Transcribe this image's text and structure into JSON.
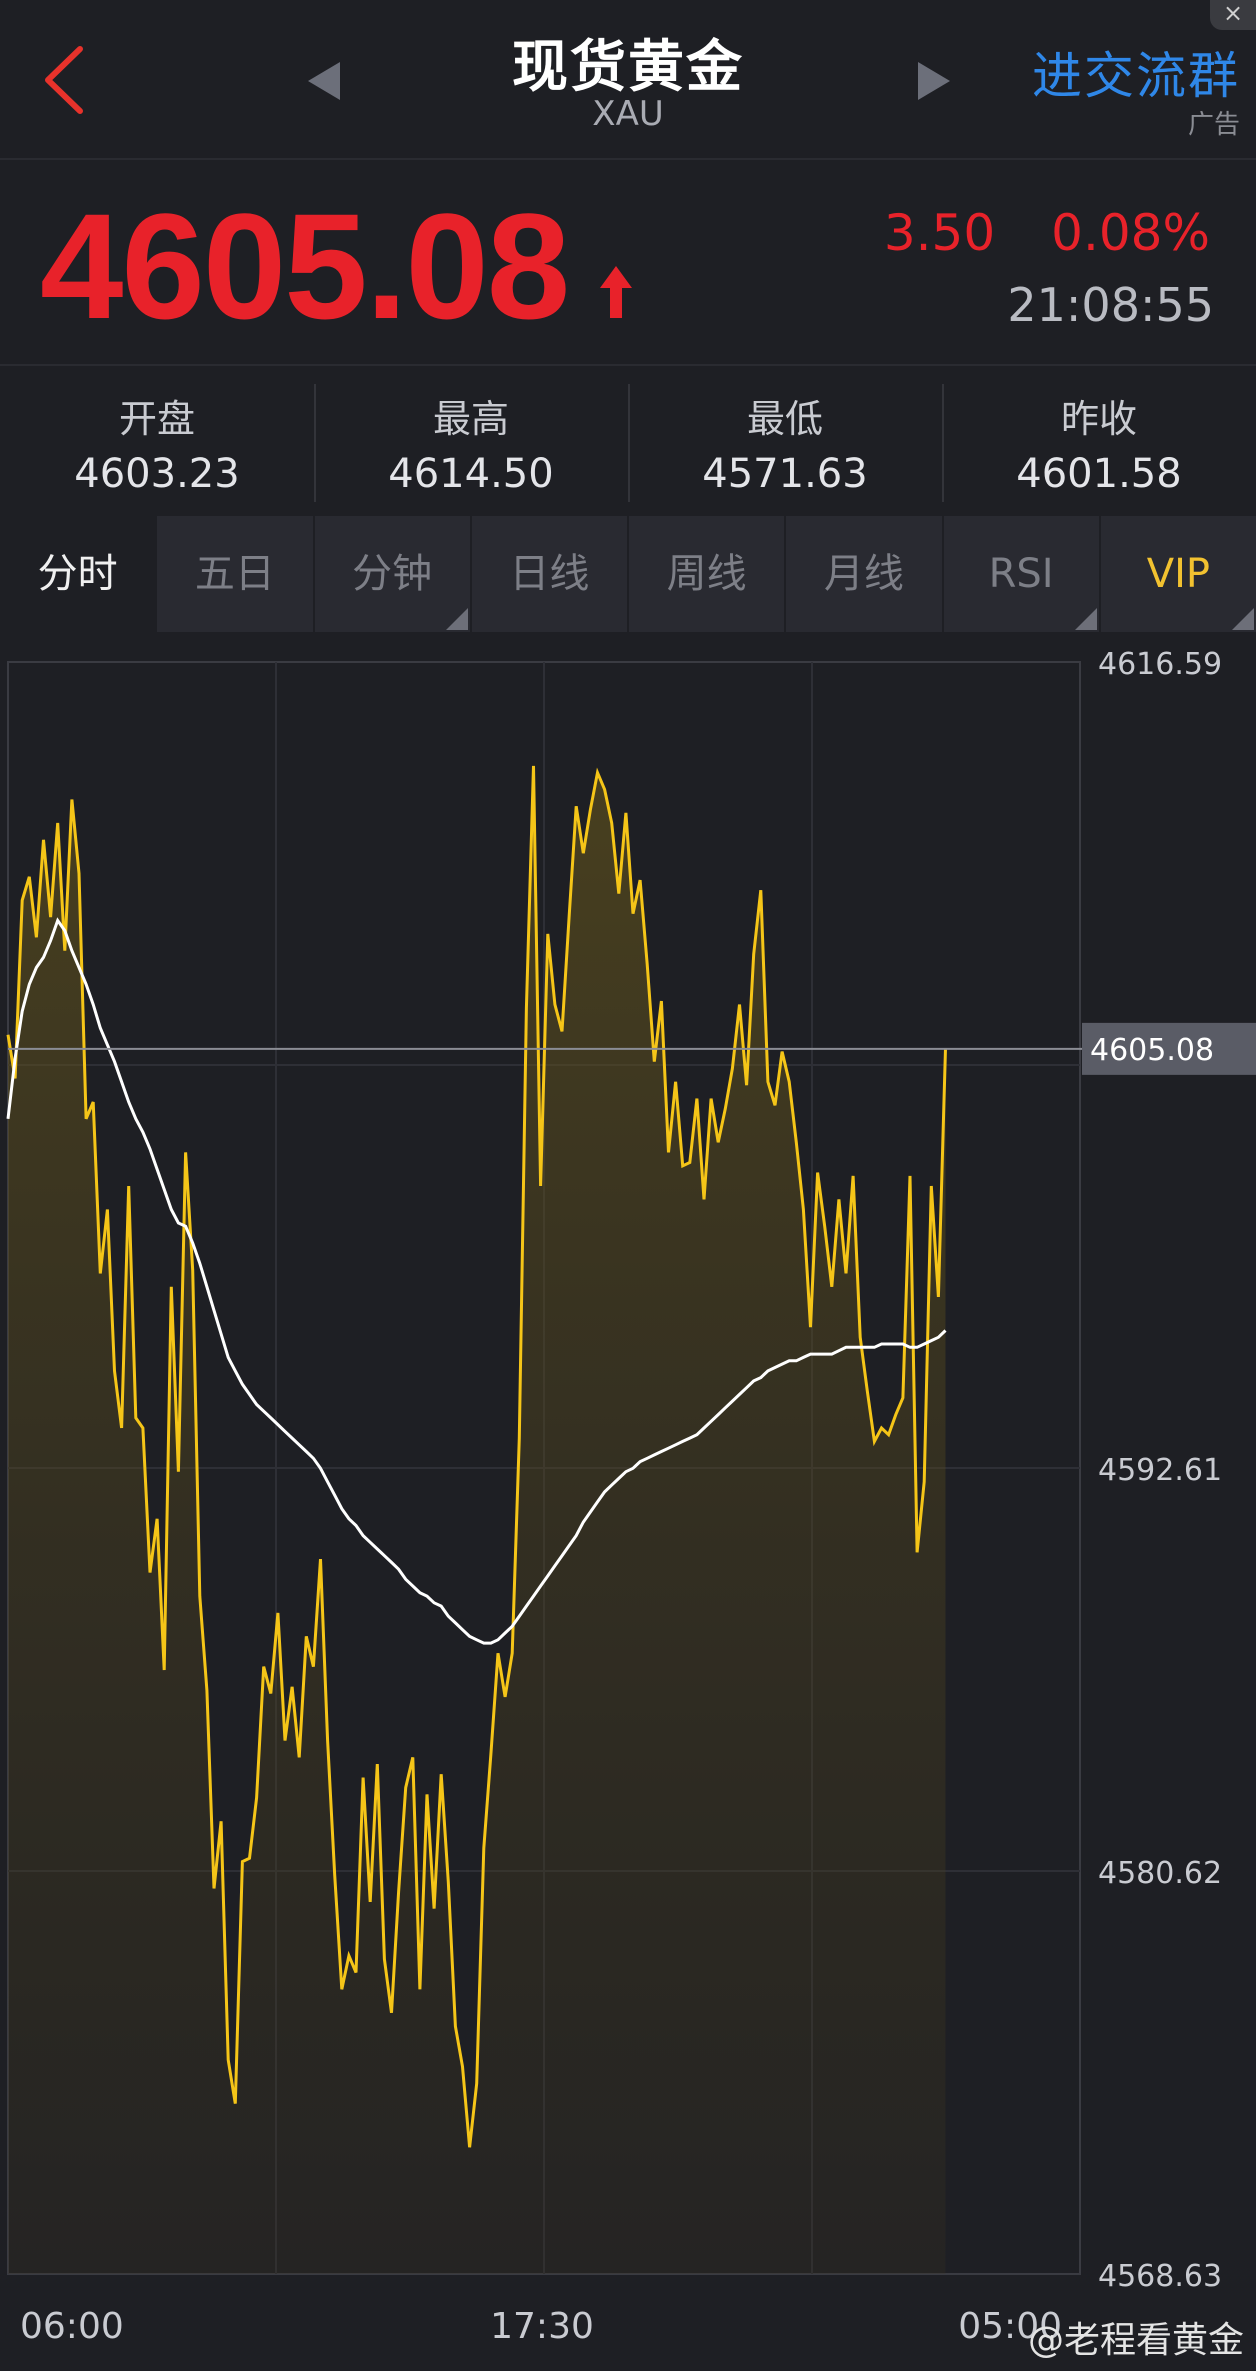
{
  "header": {
    "title": "现货黄金",
    "subtitle": "XAU",
    "ad_link": "进交流群",
    "ad_tag": "广告",
    "close": "×"
  },
  "quote": {
    "price": "4605.08",
    "change": "3.50",
    "change_pct": "0.08%",
    "time": "21:08:55",
    "up_color": "#e8222a"
  },
  "stats": [
    {
      "label": "开盘",
      "value": "4603.23"
    },
    {
      "label": "最高",
      "value": "4614.50"
    },
    {
      "label": "最低",
      "value": "4571.63"
    },
    {
      "label": "昨收",
      "value": "4601.58"
    }
  ],
  "tabs": [
    {
      "label": "分时",
      "active": true
    },
    {
      "label": "五日"
    },
    {
      "label": "分钟",
      "has_menu": true
    },
    {
      "label": "日线"
    },
    {
      "label": "周线"
    },
    {
      "label": "月线"
    },
    {
      "label": "RSI",
      "has_menu": true
    },
    {
      "label": "VIP",
      "has_menu": true
    }
  ],
  "chart_data": {
    "type": "line",
    "x_ticks": [
      "06:00",
      "17:30",
      "05:00"
    ],
    "y_ticks": [
      "4616.59",
      "4592.61",
      "4580.62",
      "4568.63"
    ],
    "ylim": [
      4568.63,
      4616.59
    ],
    "current_price_label": "4605.08",
    "current_price": 4605.08,
    "series": [
      {
        "color": "#f5c518",
        "values": [
          4605.5,
          4604.2,
          4609.5,
          4610.2,
          4608.4,
          4611.3,
          4609.0,
          4611.8,
          4608.0,
          4612.5,
          4610.3,
          4603.0,
          4603.5,
          4598.4,
          4600.3,
          4595.5,
          4593.8,
          4601.0,
          4594.1,
          4593.8,
          4589.5,
          4591.1,
          4586.6,
          4598.0,
          4592.5,
          4602.0,
          4598.5,
          4588.8,
          4586.0,
          4580.1,
          4582.1,
          4575.0,
          4573.7,
          4580.9,
          4581.0,
          4582.8,
          4586.7,
          4585.9,
          4588.3,
          4584.5,
          4586.1,
          4584.0,
          4587.6,
          4586.7,
          4589.9,
          4584.5,
          4580.5,
          4577.1,
          4578.1,
          4577.6,
          4583.4,
          4579.7,
          4583.8,
          4578.0,
          4576.4,
          4580.0,
          4583.1,
          4584.0,
          4577.1,
          4582.9,
          4579.5,
          4583.5,
          4580.3,
          4576.0,
          4574.8,
          4572.4,
          4574.3,
          4581.3,
          4584.1,
          4587.1,
          4585.8,
          4587.1,
          4593.5,
          4606.3,
          4613.5,
          4601.0,
          4608.5,
          4606.4,
          4605.6,
          4609.0,
          4612.3,
          4610.9,
          4612.2,
          4613.3,
          4612.8,
          4611.8,
          4609.7,
          4612.1,
          4609.1,
          4610.1,
          4607.6,
          4604.7,
          4606.5,
          4602.0,
          4604.1,
          4601.6,
          4601.7,
          4603.6,
          4600.6,
          4603.6,
          4602.3,
          4603.3,
          4604.5,
          4606.4,
          4604.0,
          4607.9,
          4609.8,
          4604.1,
          4603.4,
          4605.0,
          4604.1,
          4602.3,
          4600.3,
          4596.8,
          4601.4,
          4599.8,
          4598.0,
          4600.6,
          4598.4,
          4601.3,
          4596.5,
          4594.9,
          4593.4,
          4593.8,
          4593.6,
          4594.2,
          4594.7,
          4601.3,
          4590.1,
          4592.2,
          4601.0,
          4597.7,
          4605.1
        ]
      },
      {
        "color": "#ffffff",
        "values": [
          4603.0,
          4604.8,
          4606.2,
          4607.0,
          4607.5,
          4607.8,
          4608.3,
          4608.9,
          4608.6,
          4608.0,
          4607.5,
          4607.0,
          4606.4,
          4605.7,
          4605.2,
          4604.7,
          4604.1,
          4603.5,
          4603.0,
          4602.6,
          4602.1,
          4601.5,
          4600.9,
          4600.3,
          4599.9,
          4599.8,
          4599.3,
          4598.7,
          4598.0,
          4597.3,
          4596.6,
          4595.9,
          4595.5,
          4595.1,
          4594.8,
          4594.5,
          4594.3,
          4594.1,
          4593.9,
          4593.7,
          4593.5,
          4593.3,
          4593.1,
          4592.9,
          4592.6,
          4592.2,
          4591.8,
          4591.4,
          4591.1,
          4590.9,
          4590.6,
          4590.4,
          4590.2,
          4590.0,
          4589.8,
          4589.6,
          4589.3,
          4589.1,
          4588.9,
          4588.8,
          4588.6,
          4588.5,
          4588.2,
          4588.0,
          4587.8,
          4587.6,
          4587.5,
          4587.4,
          4587.4,
          4587.5,
          4587.7,
          4587.9,
          4588.2,
          4588.5,
          4588.8,
          4589.1,
          4589.4,
          4589.7,
          4590.0,
          4590.3,
          4590.6,
          4591.0,
          4591.3,
          4591.6,
          4591.9,
          4592.1,
          4592.3,
          4592.5,
          4592.6,
          4592.8,
          4592.9,
          4593.0,
          4593.1,
          4593.2,
          4593.3,
          4593.4,
          4593.5,
          4593.6,
          4593.8,
          4594.0,
          4594.2,
          4594.4,
          4594.6,
          4594.8,
          4595.0,
          4595.2,
          4595.3,
          4595.5,
          4595.6,
          4595.7,
          4595.8,
          4595.8,
          4595.9,
          4596.0,
          4596.0,
          4596.0,
          4596.0,
          4596.1,
          4596.2,
          4596.2,
          4596.2,
          4596.2,
          4596.2,
          4596.3,
          4596.3,
          4596.3,
          4596.3,
          4596.2,
          4596.2,
          4596.3,
          4596.4,
          4596.5,
          4596.7
        ]
      }
    ]
  },
  "watermark": "@老程看黄金",
  "colors": {
    "background": "#1e1f24",
    "price_line": "#f5c518",
    "avg_line": "#ffffff",
    "accent_blue": "#2f87e8",
    "vip": "#f2c230"
  }
}
